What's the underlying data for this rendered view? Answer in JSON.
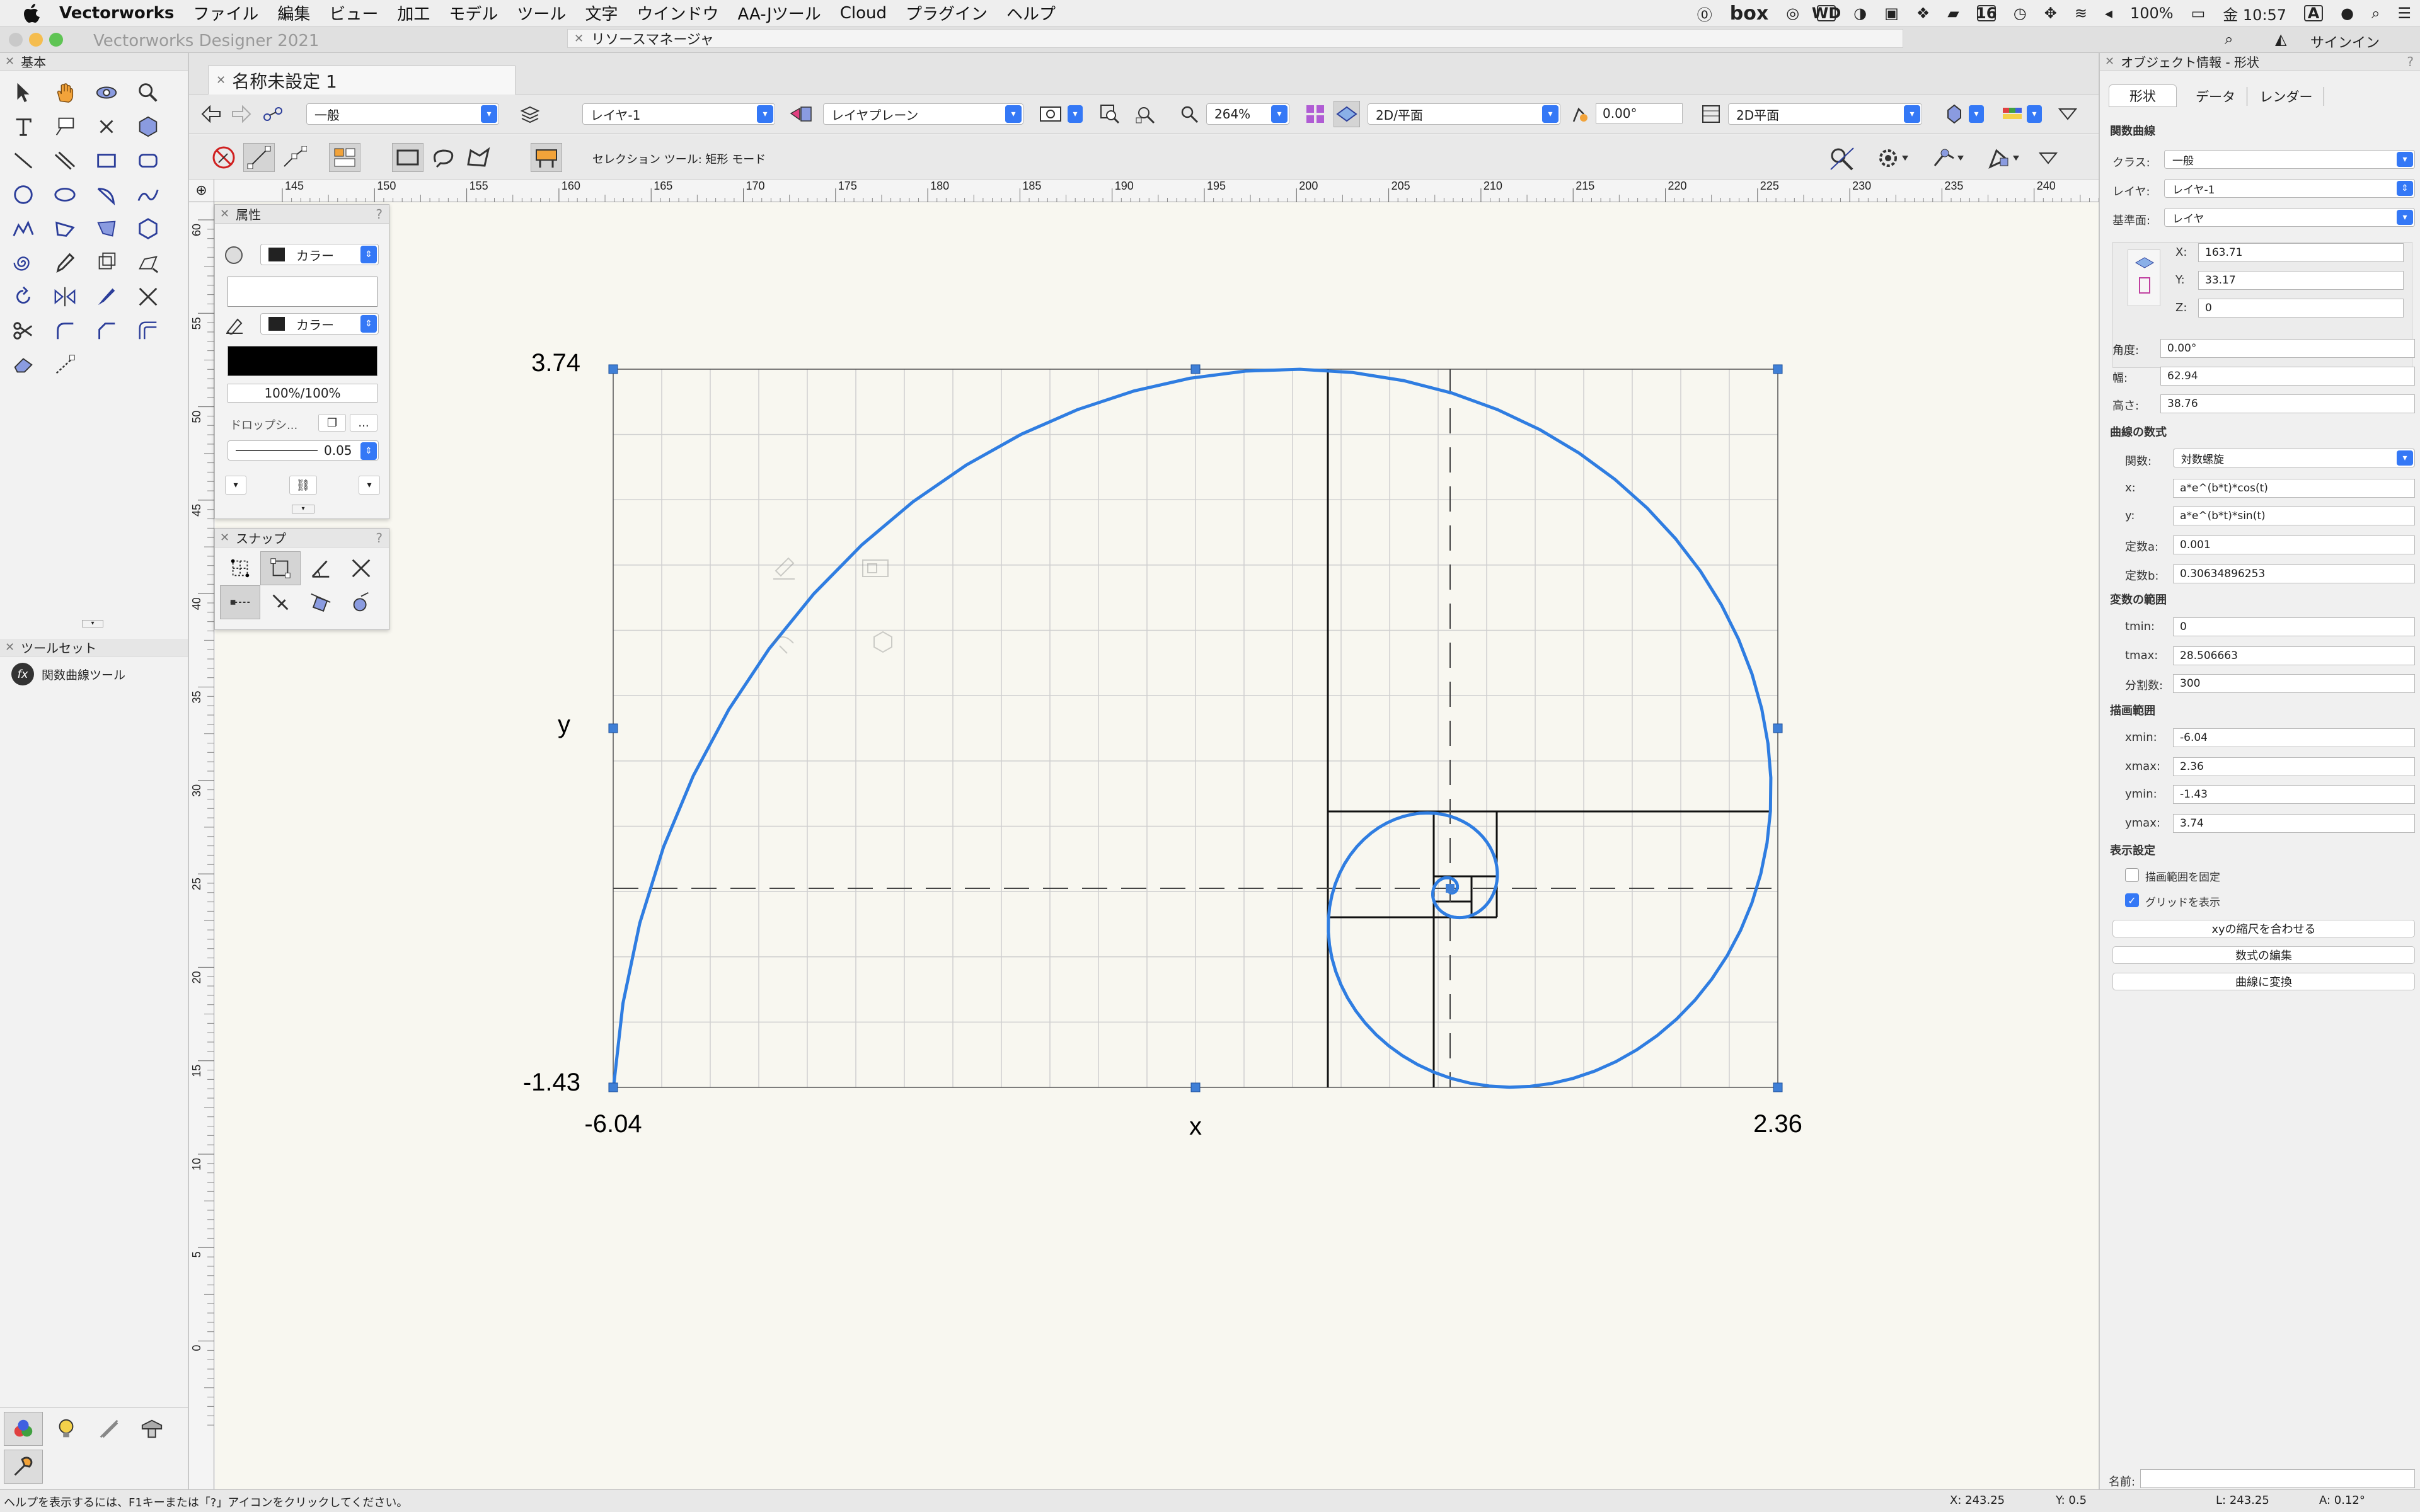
{
  "menubar": {
    "app_name": "Vectorworks",
    "items": [
      "ファイル",
      "編集",
      "ビュー",
      "加工",
      "モデル",
      "ツール",
      "文字",
      "ウインドウ",
      "AA-Jツール",
      "Cloud",
      "プラグイン",
      "ヘルプ"
    ],
    "status": {
      "box": "box",
      "wd": "WD",
      "calendar": "16",
      "battery": "100%",
      "clock": "金 10:57",
      "input": "A"
    }
  },
  "window": {
    "app_title": "Vectorworks Designer 2021",
    "resource_manager": "リソースマネージャ",
    "signin": "サインイン"
  },
  "left_palette": {
    "basic_title": "基本",
    "toolset_title": "ツールセット",
    "toolset_item": "関数曲線ツール",
    "fx_icon": "fx"
  },
  "document": {
    "tab_title": "名称未設定 1"
  },
  "toolbar1": {
    "class": "一般",
    "layer": "レイヤ-1",
    "plane": "レイヤプレーン",
    "zoom": "264%",
    "view": "2D/平面",
    "angle": "0.00°",
    "render": "2D平面"
  },
  "toolbar2": {
    "mode_text": "セレクション ツール: 矩形 モード"
  },
  "ruler": {
    "h_ticks": [
      "145",
      "150",
      "155",
      "160",
      "165",
      "170",
      "175",
      "180",
      "185",
      "190",
      "195",
      "200",
      "205",
      "210",
      "215",
      "220",
      "225",
      "230",
      "235",
      "240"
    ],
    "v_ticks": [
      "60",
      "55",
      "50",
      "45",
      "40",
      "35",
      "30",
      "25",
      "20",
      "15",
      "10",
      "5",
      "0"
    ]
  },
  "attributes_palette": {
    "title": "属性",
    "fill_label": "カラー",
    "pen_label": "カラー",
    "opacity": "100%/100%",
    "drop_shadow": "ドロップシ...",
    "more": "...",
    "line_weight": "0.05"
  },
  "snap_palette": {
    "title": "スナップ"
  },
  "plot": {
    "ymax_label": "3.74",
    "ymin_label": "-1.43",
    "xmin_label": "-6.04",
    "xmax_label": "2.36",
    "xlabel": "x",
    "ylabel": "y",
    "curve_color": "#2f7de1"
  },
  "object_info": {
    "title": "オブジェクト情報 - 形状",
    "tabs": [
      "形状",
      "データ",
      "レンダー"
    ],
    "object_type": "関数曲線",
    "class_label": "クラス:",
    "class_value": "一般",
    "layer_label": "レイヤ:",
    "layer_value": "レイヤ-1",
    "plane_label": "基準面:",
    "plane_value": "レイヤ",
    "x_label": "X:",
    "x_value": "163.71",
    "y_label": "Y:",
    "y_value": "33.17",
    "z_label": "Z:",
    "z_value": "0",
    "angle_label": "角度:",
    "angle_value": "0.00°",
    "width_label": "幅:",
    "width_value": "62.94",
    "height_label": "高さ:",
    "height_value": "38.76",
    "formula_section": "曲線の数式",
    "func_label": "関数:",
    "func_value": "対数螺旋",
    "fx_label": "x:",
    "fx_value": "a*e^(b*t)*cos(t)",
    "fy_label": "y:",
    "fy_value": "a*e^(b*t)*sin(t)",
    "a_label": "定数a:",
    "a_value": "0.001",
    "b_label": "定数b:",
    "b_value": "0.30634896253",
    "var_section": "変数の範囲",
    "tmin_label": "tmin:",
    "tmin_value": "0",
    "tmax_label": "tmax:",
    "tmax_value": "28.506663",
    "div_label": "分割数:",
    "div_value": "300",
    "draw_section": "描画範囲",
    "xmin_label": "xmin:",
    "xmin_value": "-6.04",
    "xmax_label": "xmax:",
    "xmax_value": "2.36",
    "ymin_label": "ymin:",
    "ymin_value": "-1.43",
    "ymax_label": "ymax:",
    "ymax_value": "3.74",
    "display_section": "表示設定",
    "fix_range": "描画範囲を固定",
    "show_grid": "グリッドを表示",
    "btn_scale": "xyの縮尺を合わせる",
    "btn_edit": "数式の編集",
    "btn_convert": "曲線に変換",
    "name_label": "名前:"
  },
  "statusbar": {
    "help": "ヘルプを表示するには、F1キーまたは「?」アイコンをクリックしてください。",
    "x": "X: 243.25",
    "y": "Y: 0.5",
    "l": "L: 243.25",
    "a": "A: 0.12°"
  }
}
